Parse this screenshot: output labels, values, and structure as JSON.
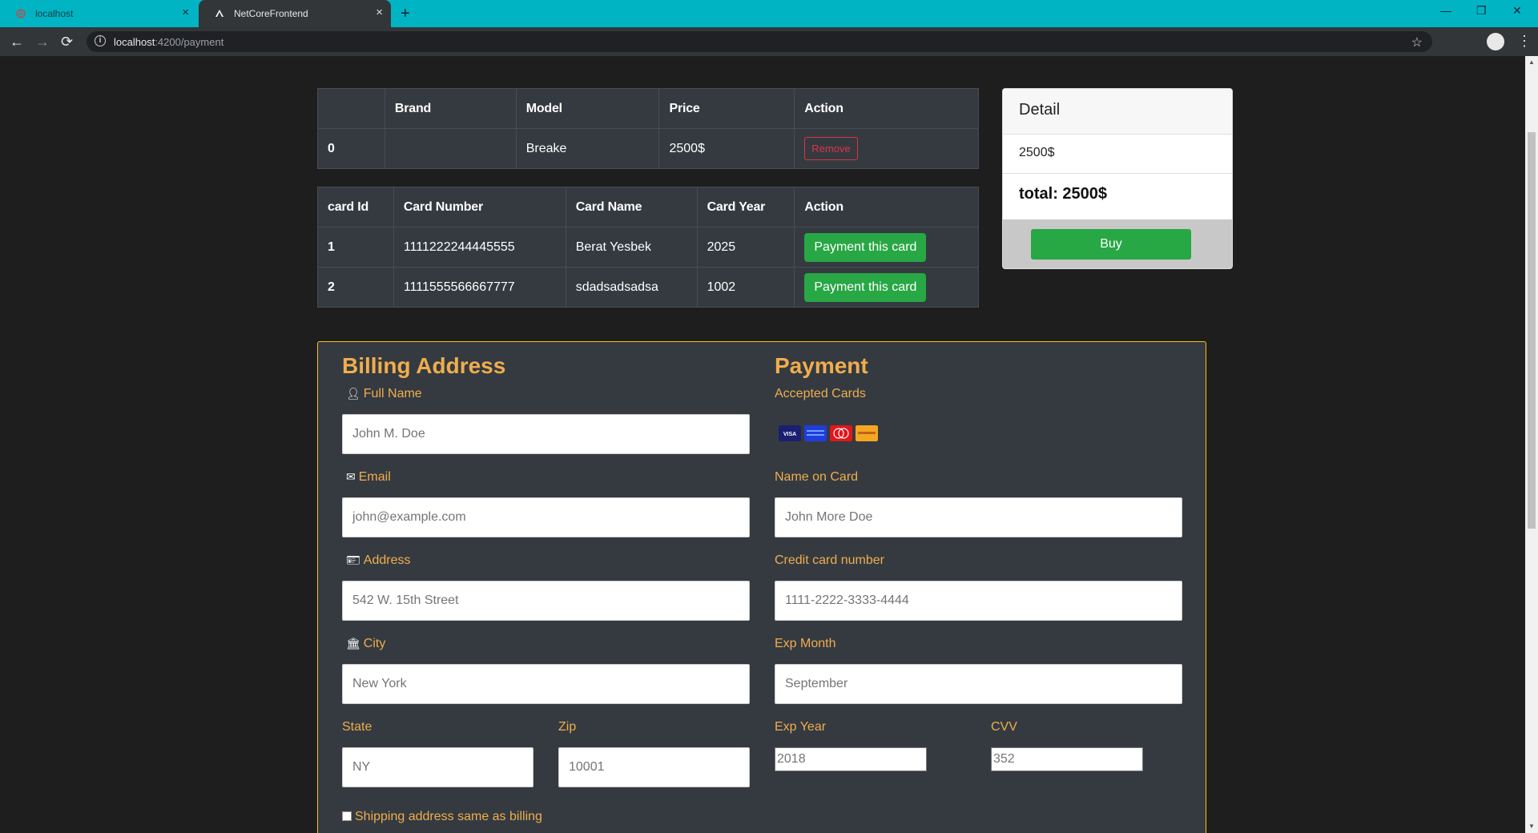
{
  "browser": {
    "tabs": [
      {
        "label": "localhost",
        "active": false
      },
      {
        "label": "NetCoreFrontend",
        "active": true
      }
    ],
    "url_host": "localhost",
    "url_path": ":4200/payment",
    "controls": {
      "back": "←",
      "forward": "→",
      "reload": "⟳",
      "new_tab": "+",
      "close": "×",
      "minimize": "—",
      "maximize": "❐",
      "window_close": "✕",
      "star": "☆",
      "menu": "⋮",
      "info": "i"
    }
  },
  "cart_table": {
    "headers": [
      "",
      "Brand",
      "Model",
      "Price",
      "Action"
    ],
    "rows": [
      {
        "index": "0",
        "brand": "",
        "model": "Breake",
        "price": "2500$",
        "action": "Remove"
      }
    ]
  },
  "cards_table": {
    "headers": [
      "card Id",
      "Card Number",
      "Card Name",
      "Card Year",
      "Action"
    ],
    "rows": [
      {
        "id": "1",
        "number": "1111222244445555",
        "name": "Berat Yesbek",
        "year": "2025",
        "action": "Payment this card"
      },
      {
        "id": "2",
        "number": "1111555566667777",
        "name": "sdadsadsadsa",
        "year": "1002",
        "action": "Payment this card"
      }
    ]
  },
  "detail": {
    "title": "Detail",
    "price": "2500$",
    "total": "total: 2500$",
    "buy_label": "Buy"
  },
  "billing": {
    "title": "Billing Address",
    "full_name_label": "Full Name",
    "full_name_placeholder": "John M. Doe",
    "email_label": "Email",
    "email_placeholder": "john@example.com",
    "address_label": "Address",
    "address_placeholder": "542 W. 15th Street",
    "city_label": "City",
    "city_placeholder": "New York",
    "state_label": "State",
    "state_placeholder": "NY",
    "zip_label": "Zip",
    "zip_placeholder": "10001",
    "same_address_label": "Shipping address same as billing"
  },
  "payment": {
    "title": "Payment",
    "accepted_cards_label": "Accepted Cards",
    "card_icons": [
      "visa-icon",
      "amex-icon",
      "mastercard-icon",
      "discover-icon"
    ],
    "name_on_card_label": "Name on Card",
    "name_on_card_placeholder": "John More Doe",
    "card_number_label": "Credit card number",
    "card_number_placeholder": "1111-2222-3333-4444",
    "exp_month_label": "Exp Month",
    "exp_month_placeholder": "September",
    "exp_year_label": "Exp Year",
    "exp_year_value": "2018",
    "cvv_label": "CVV",
    "cvv_value": "352"
  },
  "colors": {
    "tabbar": "#00b4c4",
    "accent": "#f0ad4e",
    "success": "#28a745",
    "danger": "#dc3545",
    "table_bg": "#343a40"
  }
}
